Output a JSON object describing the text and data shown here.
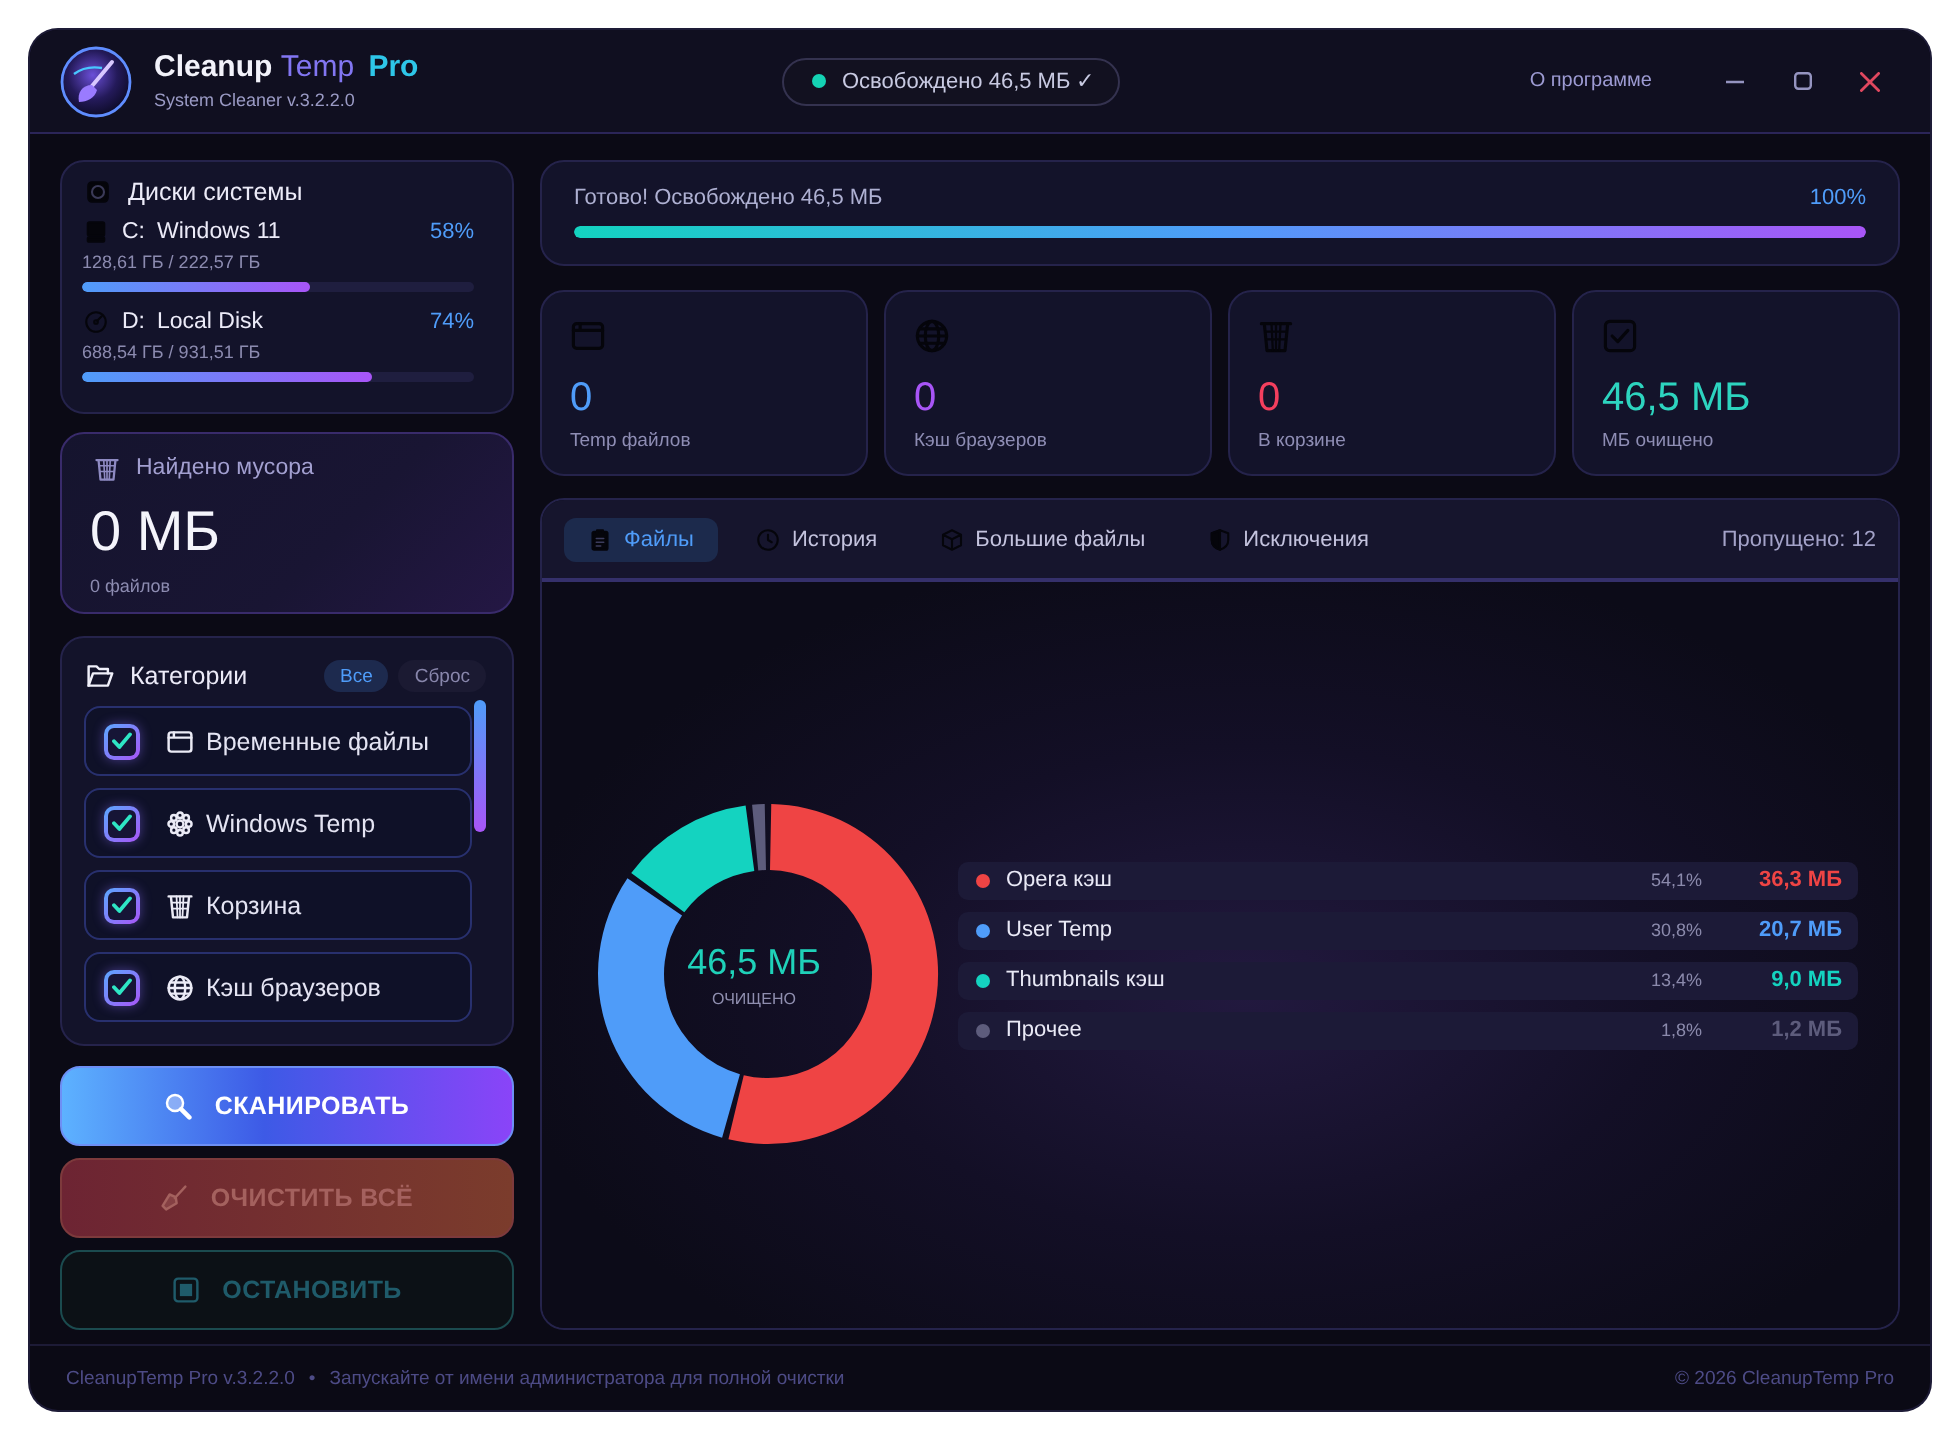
{
  "window": {
    "title": [
      "Cleanup",
      "Temp",
      "Pro"
    ],
    "subtitle": "System Cleaner v.3.2.2.0",
    "status": "Освобождено 46,5 МБ ✓",
    "about_link": "О программе"
  },
  "disks": {
    "title": "Диски системы",
    "items": [
      {
        "kind": "system",
        "letter": "C:",
        "name": "Windows 11",
        "percent": "58%",
        "usage": "128,61 ГБ / 222,57 ГБ",
        "level": 0.58
      },
      {
        "kind": "data",
        "letter": "D:",
        "name": "Local Disk",
        "percent": "74%",
        "usage": "688,54 ГБ / 931,51 ГБ",
        "level": 0.74
      }
    ]
  },
  "found": {
    "title": "Найдено мусора",
    "size": "0 МБ",
    "files": "0 файлов"
  },
  "categories": {
    "title": "Категории",
    "actions": [
      {
        "label": "Все",
        "kind": "primary"
      },
      {
        "label": "Сброс",
        "kind": "secondary"
      }
    ],
    "items": [
      {
        "label": "Временные файлы",
        "kind": "temp",
        "checked": true
      },
      {
        "label": "Windows Temp",
        "kind": "system",
        "checked": true
      },
      {
        "label": "Корзина",
        "kind": "bin",
        "checked": true
      },
      {
        "label": "Кэш браузеров",
        "kind": "browser",
        "checked": true
      }
    ]
  },
  "buttons": [
    {
      "label": "СКАНИРОВАТЬ",
      "kind": "scan",
      "disabled": false
    },
    {
      "label": "ОЧИСТИТЬ ВСЁ",
      "kind": "clean",
      "disabled": true
    },
    {
      "label": "ОСТАНОВИТЬ",
      "kind": "stop",
      "disabled": true
    }
  ],
  "progress": {
    "message": "Готово! Освобождено 46,5 МБ",
    "percent": "100%",
    "level": 1
  },
  "stats": [
    {
      "kind": "temp",
      "value": "0",
      "label": "Temp файлов",
      "color": "#4f9cf9"
    },
    {
      "kind": "browser",
      "value": "0",
      "label": "Кэш браузеров",
      "color": "#a855f7"
    },
    {
      "kind": "bin",
      "value": "0",
      "label": "В корзине",
      "color": "#f43f5e"
    },
    {
      "kind": "cleaned",
      "value": "46,5 МБ",
      "label": "МБ очищено",
      "color": "#2dd4bf"
    }
  ],
  "tabs": {
    "items": [
      {
        "label": "Файлы",
        "kind": "files",
        "selected": true
      },
      {
        "label": "История",
        "kind": "history",
        "selected": false
      },
      {
        "label": "Большие файлы",
        "kind": "large",
        "selected": false
      },
      {
        "label": "Исключения",
        "kind": "exclusions",
        "selected": false
      }
    ],
    "skipped": "Пропущено: 12"
  },
  "summary": {
    "center_value": "46,5 МБ",
    "center_label": "ОЧИЩЕНО",
    "chart_data": {
      "type": "donut",
      "categories": [
        "Opera кэш",
        "User Temp",
        "Thumbnails кэш",
        "Прочее"
      ],
      "values": [
        54.1,
        30.8,
        13.4,
        1.8
      ]
    },
    "legend": [
      {
        "percent": "54,1%",
        "size": "36,3 МБ",
        "color": "#ef4444"
      },
      {
        "percent": "30,8%",
        "size": "20,7 МБ",
        "color": "#4f9cf9"
      },
      {
        "percent": "13,4%",
        "size": "9,0 МБ",
        "color": "#14d3c0"
      },
      {
        "percent": "1,8%",
        "size": "1,2 МБ",
        "color": "#5d5c7c"
      }
    ]
  },
  "footer": {
    "version": "CleanupTemp Pro v.3.2.2.0",
    "separator": "•",
    "hint": "Запускайте от имени администратора для полной очистки",
    "copyright": "© 2026 CleanupTemp Pro"
  }
}
